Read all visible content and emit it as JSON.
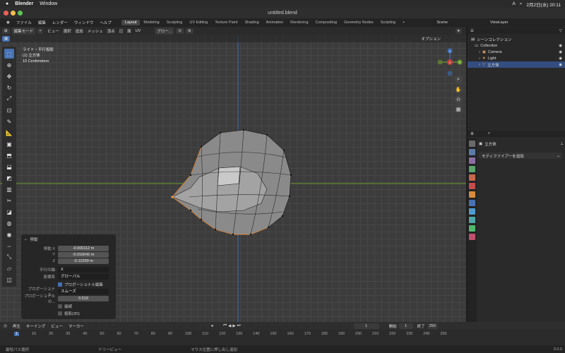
{
  "mac_menu": {
    "app": "Blender",
    "window": "Window"
  },
  "mac_status": {
    "date": "2月2日(水) 20:11",
    "input": "A"
  },
  "titlebar": {
    "filename": "untitled.blend"
  },
  "menus": [
    "ファイル",
    "編集",
    "レンダー",
    "ウィンドウ",
    "ヘルプ"
  ],
  "workspaces": [
    "Layout",
    "Modeling",
    "Sculpting",
    "UV Editing",
    "Texture Paint",
    "Shading",
    "Animation",
    "Rendering",
    "Compositing",
    "Geometry Nodes",
    "Scripting"
  ],
  "active_workspace": "Layout",
  "scene": "Scene",
  "view_layer": "ViewLayer",
  "viewport_header": {
    "mode": "編集モード",
    "menus": [
      "ビュー",
      "選択",
      "追加",
      "メッシュ",
      "頂点",
      "辺",
      "面",
      "UV"
    ],
    "transform": "グロー...",
    "options": "オプション"
  },
  "viewport_info": {
    "line1": "ライト・平行投影",
    "line2": "(1) 立方体",
    "line3": "10 Centimeters"
  },
  "gizmo": {
    "x": "X",
    "y": "Y",
    "z": "Z"
  },
  "ops_panel": {
    "title": "移動",
    "move_label": "移動 X",
    "y_label": "Y",
    "z_label": "Z",
    "x_val": "-0.000112 m",
    "y_val": "-0.016042 m",
    "z_val": "-0.12299 m",
    "axis_label": "平行の軸",
    "axis_val": "X",
    "orient_label": "座標系",
    "orient_val": "グローバル",
    "prop_edit": "プロポーショナル編集",
    "falloff_label": "プロポーショナル...",
    "falloff_val": "スムーズ",
    "size_label": "プロポーショナルの...",
    "size_val": "0.519",
    "connected": "接続",
    "projected": "投影(2D)"
  },
  "outliner": {
    "scene_collection": "シーンコレクション",
    "items": [
      {
        "label": "Collection"
      },
      {
        "label": "Camera"
      },
      {
        "label": "Light"
      },
      {
        "label": "立方体"
      }
    ]
  },
  "properties": {
    "object_name": "立方体",
    "add_modifier": "モディファイアーを追加"
  },
  "timeline": {
    "menus": [
      "再生",
      "キーイング",
      "ビュー",
      "マーカー"
    ],
    "current_frame": "1",
    "start_label": "開始",
    "start": "1",
    "end_label": "終了",
    "end": "250",
    "ticks": [
      "10",
      "20",
      "30",
      "40",
      "50",
      "60",
      "70",
      "80",
      "90",
      "100",
      "110",
      "120",
      "130",
      "140",
      "150",
      "160",
      "170",
      "180",
      "190",
      "200",
      "210",
      "220",
      "230",
      "240",
      "250"
    ],
    "first_tick": "1"
  },
  "statusbar": {
    "left": "最短パス選択",
    "mid": "ドリービュー",
    "right": "マウス位置に押し出し追加",
    "version": "3.0.0"
  },
  "colors": {
    "accent": "#4772b3",
    "x_axis": "#c2403d",
    "y_axis": "#6b9a2d",
    "z_axis": "#3d6fb5",
    "selected_row": "#334d80"
  }
}
